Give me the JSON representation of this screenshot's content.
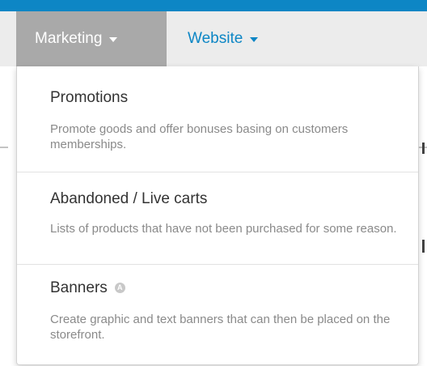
{
  "nav": {
    "marketing_label": "Marketing",
    "website_label": "Website"
  },
  "dropdown": {
    "items": [
      {
        "title": "Promotions",
        "description": "Promote goods and offer bonuses basing on customers memberships."
      },
      {
        "title": "Abandoned / Live carts",
        "description": "Lists of products that have not been purchased for some reason."
      },
      {
        "title": "Banners",
        "badge": "A",
        "description": "Create graphic and text banners that can then be placed on the storefront."
      }
    ]
  },
  "colors": {
    "accent": "#0d86c5",
    "active_tab": "#a9a9a9",
    "nav_bar": "#ececec",
    "muted_text": "#8a8a8a"
  }
}
